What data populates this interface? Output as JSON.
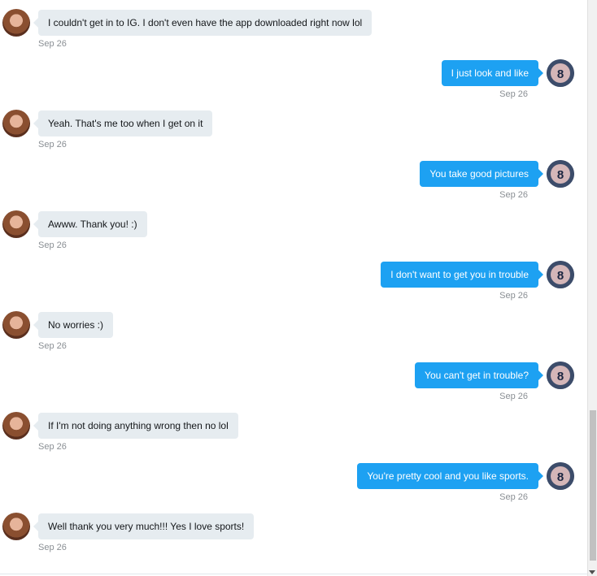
{
  "messages": [
    {
      "from": "them",
      "text": "I couldn't get in to IG. I don't even have the app downloaded right now lol",
      "time": "Sep 26"
    },
    {
      "from": "me",
      "text": "I just look and like",
      "time": "Sep 26"
    },
    {
      "from": "them",
      "text": "Yeah. That's me too when I get on it",
      "time": "Sep 26"
    },
    {
      "from": "me",
      "text": "You take good pictures",
      "time": "Sep 26"
    },
    {
      "from": "them",
      "text": "Awww. Thank you! :)",
      "time": "Sep 26"
    },
    {
      "from": "me",
      "text": "I don't want to get you in trouble",
      "time": "Sep 26"
    },
    {
      "from": "them",
      "text": "No worries :)",
      "time": "Sep 26"
    },
    {
      "from": "me",
      "text": "You can't get in trouble?",
      "time": "Sep 26"
    },
    {
      "from": "them",
      "text": "If I'm not doing anything wrong then no lol",
      "time": "Sep 26"
    },
    {
      "from": "me",
      "text": "You're pretty cool and you like sports.",
      "time": "Sep 26"
    },
    {
      "from": "them",
      "text": "Well thank you very much!!!  Yes I love sports!",
      "time": "Sep 26"
    }
  ],
  "colors": {
    "sent_bubble": "#1da1f2",
    "received_bubble": "#e6ecf0",
    "timestamp": "#8a8f94"
  },
  "icons": {
    "them_avatar": "avatar-photo-icon",
    "me_avatar": "eight-ball-avatar-icon"
  }
}
